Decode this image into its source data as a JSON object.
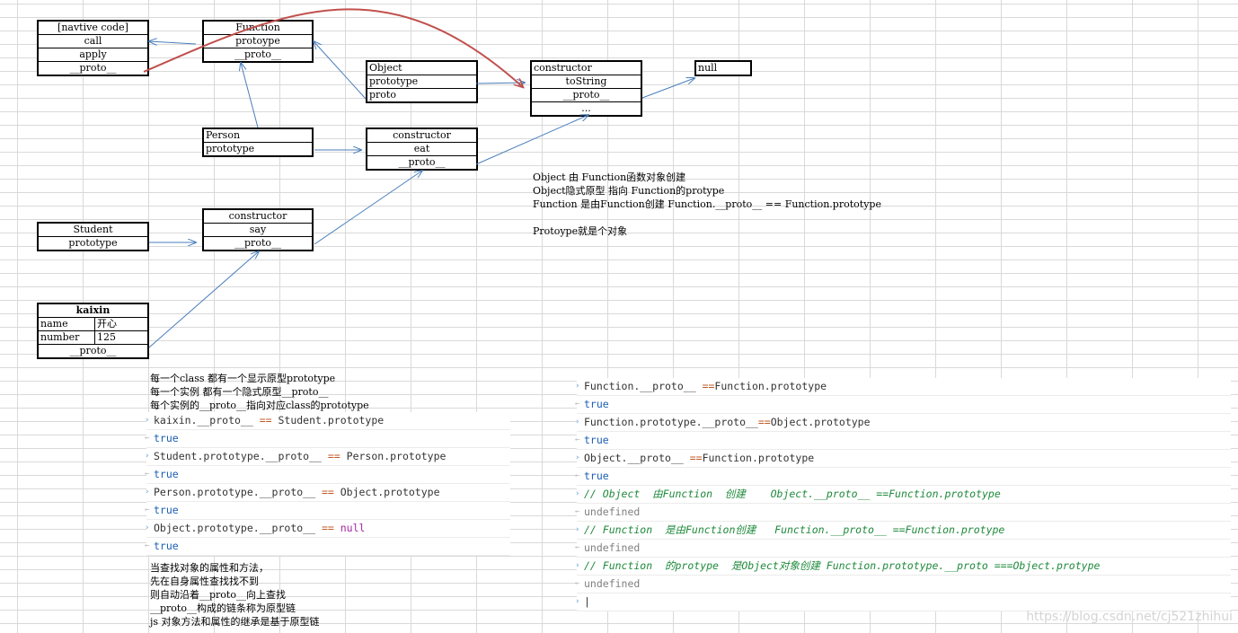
{
  "diagram": {
    "native_box": {
      "rows": [
        "[navtive code]",
        "call",
        "apply",
        "__proto__"
      ]
    },
    "function_box": {
      "rows": [
        "Function",
        "protoype",
        "__proto__"
      ]
    },
    "object_box": {
      "rows": [
        "Object",
        "prototype",
        "proto"
      ]
    },
    "object_proto_box": {
      "rows": [
        "constructor",
        "toString",
        "__proto__",
        "..."
      ]
    },
    "null_box": {
      "rows": [
        "null"
      ]
    },
    "person_box": {
      "rows": [
        "Person",
        "prototype"
      ]
    },
    "person_proto_box": {
      "rows": [
        "constructor",
        "eat",
        "__proto__"
      ]
    },
    "student_box": {
      "rows": [
        "Student",
        "prototype"
      ]
    },
    "student_proto_box": {
      "rows": [
        "constructor",
        "say",
        "__proto__"
      ]
    },
    "kaixin_box": {
      "title": "kaixin",
      "fields": [
        {
          "key": "name",
          "value": "开心"
        },
        {
          "key": "number",
          "value": "125"
        }
      ],
      "proto": "__proto__"
    }
  },
  "notes": {
    "object_notes": [
      "Object 由 Function函数对象创建",
      "Object隐式原型 指向 Function的protype",
      "Function 是由Function创建 Function.__proto__ == Function.prototype",
      "",
      "Protoype就是个对象"
    ],
    "class_notes": [
      "每一个class 都有一个显示原型prototype",
      "每一个实例 都有一个隐式原型__proto__",
      "每个实例的__proto__指向对应class的prototype"
    ],
    "lookup_notes": [
      "当查找对象的属性和方法，",
      "先在自身属性查找找不到",
      "则自动沿着__proto__向上查找",
      "__proto__构成的链条称为原型链",
      "js 对象方法和属性的继承是基于原型链"
    ]
  },
  "console_left": {
    "lines": [
      {
        "kind": "input",
        "parts": [
          {
            "t": "kaixin.__proto__ ",
            "c": "plain"
          },
          {
            "t": "==",
            "c": "op"
          },
          {
            "t": " Student.prototype",
            "c": "plain"
          }
        ]
      },
      {
        "kind": "result",
        "parts": [
          {
            "t": "true",
            "c": "true"
          }
        ]
      },
      {
        "kind": "input",
        "parts": [
          {
            "t": "Student.prototype.__proto__ ",
            "c": "plain"
          },
          {
            "t": "==",
            "c": "op"
          },
          {
            "t": " Person.prototype",
            "c": "plain"
          }
        ]
      },
      {
        "kind": "result",
        "parts": [
          {
            "t": "true",
            "c": "true"
          }
        ]
      },
      {
        "kind": "input",
        "parts": [
          {
            "t": "Person.prototype.__proto__ ",
            "c": "plain"
          },
          {
            "t": "==",
            "c": "op"
          },
          {
            "t": " Object.prototype",
            "c": "plain"
          }
        ]
      },
      {
        "kind": "result",
        "parts": [
          {
            "t": "true",
            "c": "true"
          }
        ]
      },
      {
        "kind": "input",
        "parts": [
          {
            "t": "Object.prototype.__proto__ ",
            "c": "plain"
          },
          {
            "t": "==",
            "c": "op"
          },
          {
            "t": " null",
            "c": "null"
          }
        ]
      },
      {
        "kind": "result",
        "parts": [
          {
            "t": "true",
            "c": "true"
          }
        ]
      }
    ]
  },
  "console_right": {
    "lines": [
      {
        "kind": "input",
        "parts": [
          {
            "t": "Function.__proto__ ",
            "c": "plain"
          },
          {
            "t": "==",
            "c": "op"
          },
          {
            "t": "Function.prototype",
            "c": "plain"
          }
        ]
      },
      {
        "kind": "result",
        "parts": [
          {
            "t": "true",
            "c": "true"
          }
        ]
      },
      {
        "kind": "input",
        "parts": [
          {
            "t": "Function.prototype.__proto__",
            "c": "plain"
          },
          {
            "t": "==",
            "c": "op"
          },
          {
            "t": "Object.prototype",
            "c": "plain"
          }
        ]
      },
      {
        "kind": "result",
        "parts": [
          {
            "t": "true",
            "c": "true"
          }
        ]
      },
      {
        "kind": "input",
        "parts": [
          {
            "t": "Object.__proto__ ",
            "c": "plain"
          },
          {
            "t": "==",
            "c": "op"
          },
          {
            "t": "Function.prototype",
            "c": "plain"
          }
        ]
      },
      {
        "kind": "result",
        "parts": [
          {
            "t": "true",
            "c": "true"
          }
        ]
      },
      {
        "kind": "input",
        "parts": [
          {
            "t": "// Object  由Function  创建    Object.__proto__ ==Function.prototype",
            "c": "cmt"
          }
        ]
      },
      {
        "kind": "result",
        "parts": [
          {
            "t": "undefined",
            "c": "undef"
          }
        ]
      },
      {
        "kind": "input",
        "parts": [
          {
            "t": "// Function  是由Function创建   Function.__proto__ ==Function.protype",
            "c": "cmt"
          }
        ]
      },
      {
        "kind": "result",
        "parts": [
          {
            "t": "undefined",
            "c": "undef"
          }
        ]
      },
      {
        "kind": "input",
        "parts": [
          {
            "t": "// Function  的protype  是Object对象创建 Function.prototype.__proto ===Object.protype",
            "c": "cmt"
          }
        ]
      },
      {
        "kind": "result",
        "parts": [
          {
            "t": "undefined",
            "c": "undef"
          }
        ]
      },
      {
        "kind": "prompt",
        "parts": [
          {
            "t": "|",
            "c": "plain"
          }
        ]
      }
    ]
  },
  "watermark": "https://blog.csdn.net/cj521zhihui",
  "colors": {
    "arrow": "#4a7ebb",
    "curve": "#c0504d",
    "console_true": "#1a5fb4",
    "console_comment": "#1f8a3c"
  }
}
